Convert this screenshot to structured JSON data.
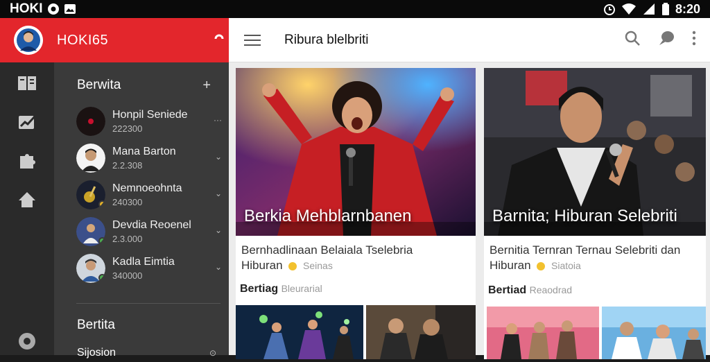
{
  "status_bar": {
    "app_name": "HOKI",
    "time": "8:20"
  },
  "drawer": {
    "title": "HOKI65",
    "section1_title": "Berwita",
    "section2_title": "Bertita",
    "section3_title": "Sijosion",
    "contacts": [
      {
        "name": "Honpil Seniede",
        "sub": "222300"
      },
      {
        "name": "Mana Barton",
        "sub": "2.2.308"
      },
      {
        "name": "Nemnoeohnta",
        "sub": "240300"
      },
      {
        "name": "Devdia Reoenel",
        "sub": "2.3.000"
      },
      {
        "name": "Kadla Eimtia",
        "sub": "340000"
      }
    ]
  },
  "toolbar": {
    "title": "Ribura blelbriti"
  },
  "cards": [
    {
      "image_title": "Berkia  Mehblarnbanen",
      "desc_line1": "Bernhadlinaan Belaiala Tselebria",
      "desc_line2": "Hiburan",
      "desc_muted": "Seinas",
      "tag": "Bertiag",
      "tag_muted": "Bleurarial"
    },
    {
      "image_title": "Barnita; Hiburan Selebriti",
      "desc_line1": "Bernitia Ternran Ternau Selebriti dan",
      "desc_line2": "Hiburan",
      "desc_muted": "Siatoia",
      "tag": "Bertiad",
      "tag_muted": "Reaodrad"
    }
  ],
  "colors": {
    "accent": "#e3262c",
    "rail": "#2a2a2a",
    "drawer": "#3a3a3a",
    "main_bg": "#ececec"
  }
}
